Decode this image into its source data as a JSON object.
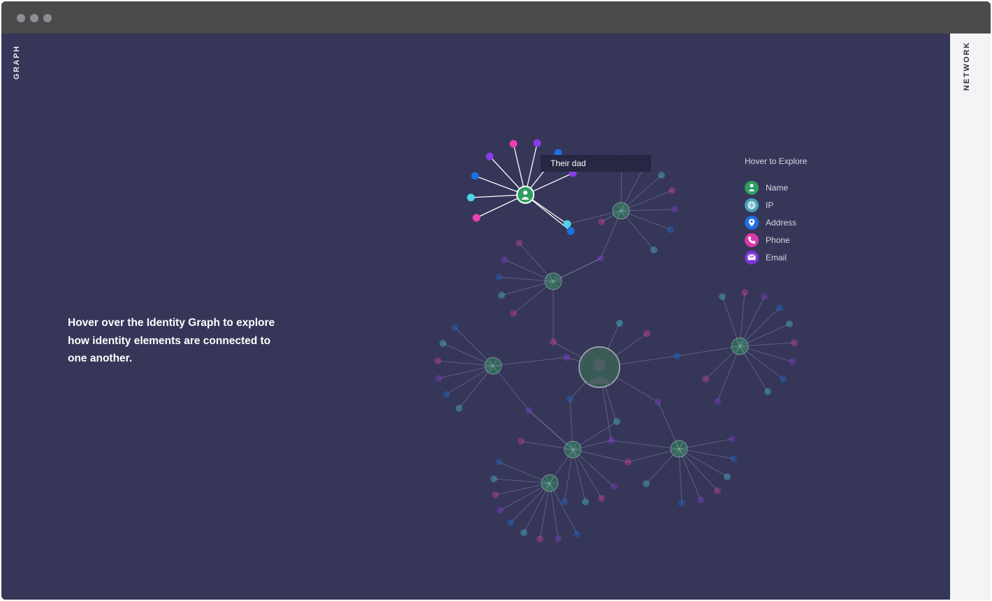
{
  "window": {
    "controls": [
      "close",
      "minimize",
      "maximize"
    ]
  },
  "left_tab": {
    "label": "GRAPH"
  },
  "right_tab": {
    "label": "NETWORK"
  },
  "intro": {
    "text": "Hover over the Identity Graph to explore how identity elements are connected to one another."
  },
  "tooltip": {
    "text": "Their dad"
  },
  "legend": {
    "title": "Hover to Explore",
    "items": [
      {
        "label": "Name",
        "icon": "person-icon",
        "color": "#2f9e62"
      },
      {
        "label": "IP",
        "icon": "globe-icon",
        "color": "#4aa3b8"
      },
      {
        "label": "Address",
        "icon": "location-pin-icon",
        "color": "#1f6fe0"
      },
      {
        "label": "Phone",
        "icon": "phone-icon",
        "color": "#d63aa6"
      },
      {
        "label": "Email",
        "icon": "envelope-icon",
        "color": "#7a35d6"
      }
    ]
  },
  "colors": {
    "background": "#353658",
    "hub": "#2f9e62",
    "ip": "#4ed3e8",
    "address": "#1f6fe0",
    "phone": "#ee3fb3",
    "email": "#8a3de6"
  }
}
